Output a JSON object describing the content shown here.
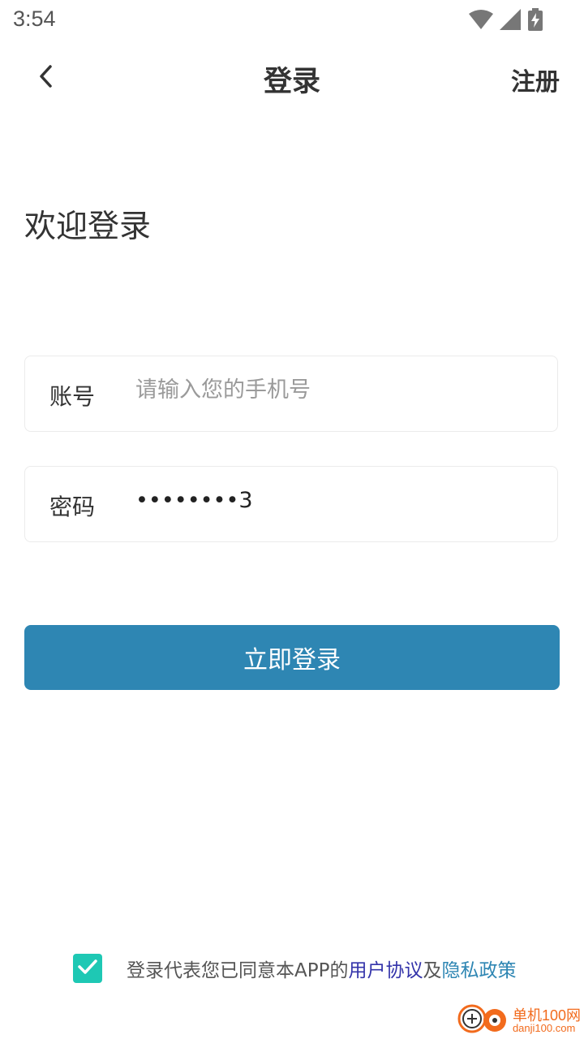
{
  "status_bar": {
    "time": "3:54",
    "icons": [
      "wifi-icon",
      "signal-icon",
      "battery-charging-icon"
    ]
  },
  "nav": {
    "back_icon": "chevron-left-icon",
    "title": "登录",
    "register_label": "注册"
  },
  "welcome_text": "欢迎登录",
  "form": {
    "account": {
      "label": "账号",
      "value": "",
      "placeholder": "请输入您的手机号"
    },
    "password": {
      "label": "密码",
      "value": "••••••••3"
    }
  },
  "login_button_label": "立即登录",
  "agreement": {
    "checked": true,
    "prefix": "登录代表您已同意本APP的",
    "user_agreement": "用户协议",
    "conjunction": "及",
    "privacy_policy": "隐私政策"
  },
  "watermark": {
    "main": "单机100网",
    "sub": "danji100.com"
  },
  "colors": {
    "accent": "#2e86b3",
    "checkbox": "#1ec8b4",
    "user_agreement_link": "#3333aa",
    "watermark": "#f26b1d"
  }
}
